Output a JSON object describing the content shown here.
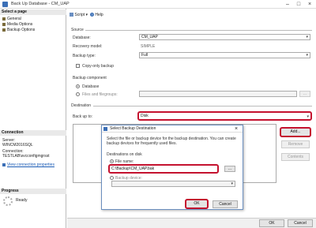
{
  "window": {
    "title": "Back Up Database - CM_UAP"
  },
  "sidebar": {
    "select_page_header": "Select a page",
    "pages": [
      "General",
      "Media Options",
      "Backup Options"
    ],
    "connection_header": "Connection",
    "server_label": "Server:",
    "server_value": "WINCM2016SQL",
    "connection_label": "Connection:",
    "connection_value": "TESTLAB\\svcconfigmgrsst",
    "view_connection_link": "View connection properties",
    "progress_header": "Progress",
    "progress_status": "Ready"
  },
  "toolbar": {
    "script_label": "Script",
    "help_label": "Help"
  },
  "source": {
    "group_label": "Source",
    "database_label": "Database:",
    "database_value": "CM_UAP",
    "recovery_label": "Recovery model:",
    "recovery_value": "SIMPLE",
    "backup_type_label": "Backup type:",
    "backup_type_value": "Full",
    "copy_only_label": "Copy-only backup",
    "component_label": "Backup component",
    "database_radio": "Database",
    "files_radio": "Files and filegroups:"
  },
  "destination": {
    "group_label": "Destination",
    "back_up_to_label": "Back up to:",
    "back_up_to_value": "Disk",
    "add_button": "Add...",
    "remove_button": "Remove",
    "contents_button": "Contents"
  },
  "dialog": {
    "title": "Select Backup Destination",
    "description": "Select the file or backup device for the backup destination. You can create backup devices for frequently used files.",
    "destinations_label": "Destinations on disk",
    "file_name_label": "File name:",
    "file_name_value": "C:\\Backup\\CM_UAP.bak",
    "browse_button": "...",
    "backup_device_label": "Backup device:",
    "ok_button": "OK",
    "cancel_button": "Cancel"
  },
  "footer": {
    "ok_button": "OK",
    "cancel_button": "Cancel"
  },
  "colors": {
    "highlight": "#c4122f",
    "link": "#1a5bb5"
  }
}
